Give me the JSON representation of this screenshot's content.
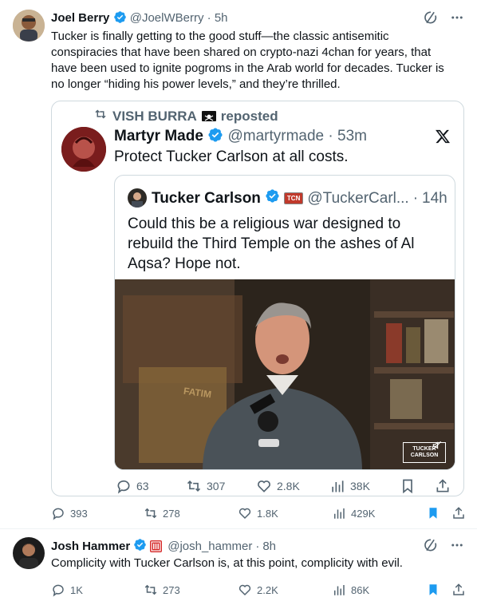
{
  "tweet1": {
    "author_name": "Joel Berry",
    "handle": "@JoelWBerry",
    "time": "5h",
    "text": "Tucker is finally getting to the good stuff—the classic antisemitic conspiracies that have been shared on crypto-nazi 4chan for years, that have been used to ignite pogroms in the Arab world for decades. Tucker is no longer “hiding his power levels,” and they’re thrilled.",
    "repost_label": "VISH BURRA",
    "repost_suffix": "reposted",
    "quoted": {
      "author_name": "Martyr Made",
      "handle": "@martyrmade",
      "time": "53m",
      "text": "Protect Tucker Carlson at all costs.",
      "inner": {
        "author_name": "Tucker Carlson",
        "handle": "@TuckerCarl...",
        "time": "14h",
        "badge": "TCN",
        "text": "Could this be a religious war designed to rebuild the Third Temple on the ashes of Al Aqsa? Hope not.",
        "video_text": "FATIM",
        "watermark": "TUCKER CARLSON"
      },
      "stats": {
        "replies": "63",
        "reposts": "307",
        "likes": "2.8K",
        "views": "38K"
      }
    },
    "stats": {
      "replies": "393",
      "reposts": "278",
      "likes": "1.8K",
      "views": "429K"
    }
  },
  "tweet2": {
    "author_name": "Josh Hammer",
    "handle": "@josh_hammer",
    "time": "8h",
    "text": "Complicity with Tucker Carlson is, at this point, complicity with evil.",
    "stats": {
      "replies": "1K",
      "reposts": "273",
      "likes": "2.2K",
      "views": "86K"
    }
  },
  "colors": {
    "blue": "#1d9bf0",
    "muted": "#536471",
    "border": "#cfd9de"
  },
  "separator": "·"
}
